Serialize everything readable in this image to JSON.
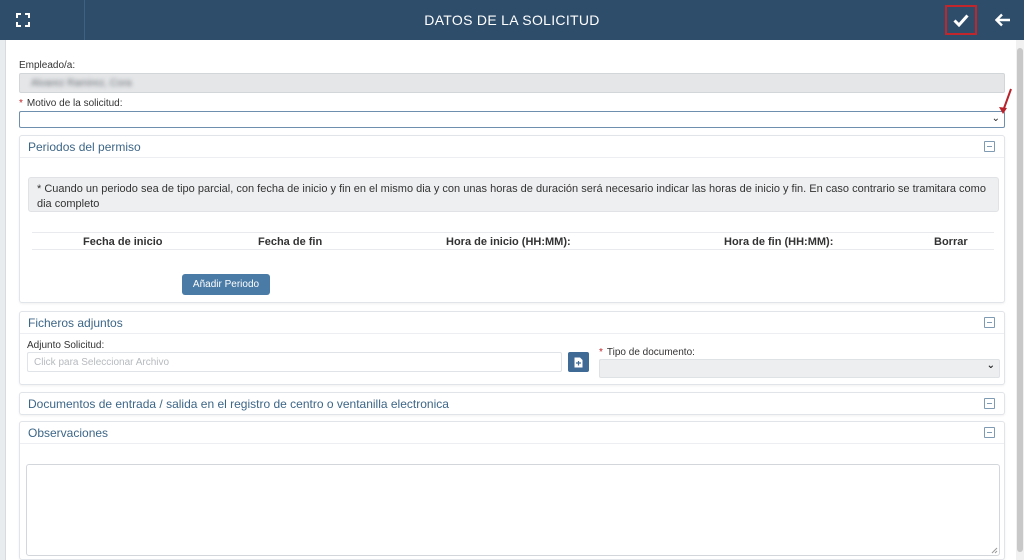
{
  "header": {
    "title": "DATOS DE LA SOLICITUD",
    "expand_icon": "fullscreen-icon",
    "confirm_icon": "check-icon",
    "back_icon": "arrow-left-icon",
    "bar_color": "#2e4d6b",
    "confirm_highlight_color": "#c0262c"
  },
  "form": {
    "employee_label": "Empleado/a:",
    "employee_value": "Alvarez Ramirez, Cora",
    "reason_label": "Motivo de la solicitud:",
    "reason_value": "",
    "required_mark": "*"
  },
  "periods": {
    "title": "Periodos del permiso",
    "notice": "* Cuando un periodo sea de tipo parcial, con fecha de inicio y fin en el mismo dia y con unas horas de duración será necesario indicar las horas de inicio y fin. En caso contrario se tramitara como dia completo",
    "columns": [
      "Fecha de inicio",
      "Fecha de fin",
      "Hora de inicio (HH:MM):",
      "Hora de fin (HH:MM):",
      "Borrar"
    ],
    "add_button": "Añadir Periodo"
  },
  "attachments": {
    "title": "Ficheros adjuntos",
    "file_label": "Adjunto Solicitud:",
    "file_placeholder": "Click para Seleccionar Archivo",
    "doc_type_label": "Tipo de documento:",
    "doc_type_value": ""
  },
  "registry": {
    "title": "Documentos de entrada / salida en el registro de centro o ventanilla electronica"
  },
  "observations": {
    "title": "Observaciones",
    "value": ""
  }
}
